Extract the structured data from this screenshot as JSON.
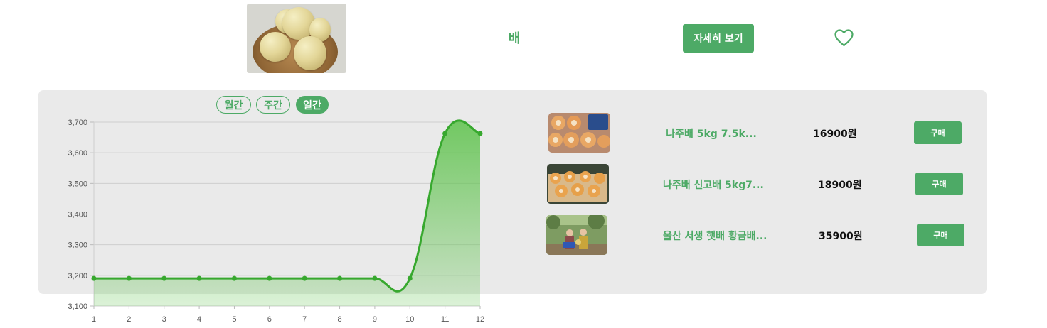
{
  "product": {
    "image_icon": "pear-photo",
    "name": "배",
    "detail_button": "자세히 보기",
    "favorite_icon": "heart-icon"
  },
  "period_tabs": [
    {
      "label": "월간",
      "active": false
    },
    {
      "label": "주간",
      "active": false
    },
    {
      "label": "일간",
      "active": true
    }
  ],
  "colors": {
    "accent": "#4daa66",
    "line": "#37a82e",
    "panel": "#eaeaea"
  },
  "chart_data": {
    "type": "area",
    "x": [
      1,
      2,
      3,
      4,
      5,
      6,
      7,
      8,
      9,
      10,
      11,
      12
    ],
    "values": [
      3190,
      3190,
      3190,
      3190,
      3190,
      3190,
      3190,
      3190,
      3190,
      3190,
      3663,
      3663
    ],
    "ylim": [
      3100,
      3700
    ],
    "yticks": [
      "3,100",
      "3,200",
      "3,300",
      "3,400",
      "3,500",
      "3,600",
      "3,700"
    ],
    "xticks": [
      "1",
      "2",
      "3",
      "4",
      "5",
      "6",
      "7",
      "8",
      "9",
      "10",
      "11",
      "12"
    ],
    "grid": true
  },
  "shop_items": [
    {
      "image_icon": "pear-gift-box-photo",
      "title": "나주배 5kg 7.5k...",
      "price": "16900원",
      "buy_label": "구매"
    },
    {
      "image_icon": "pear-tray-photo",
      "title": "나주배 신고배 5kg7...",
      "price": "18900원",
      "buy_label": "구매"
    },
    {
      "image_icon": "orchard-farmers-photo",
      "title": "울산 서생 햇배 황금배...",
      "price": "35900원",
      "buy_label": "구매"
    }
  ]
}
